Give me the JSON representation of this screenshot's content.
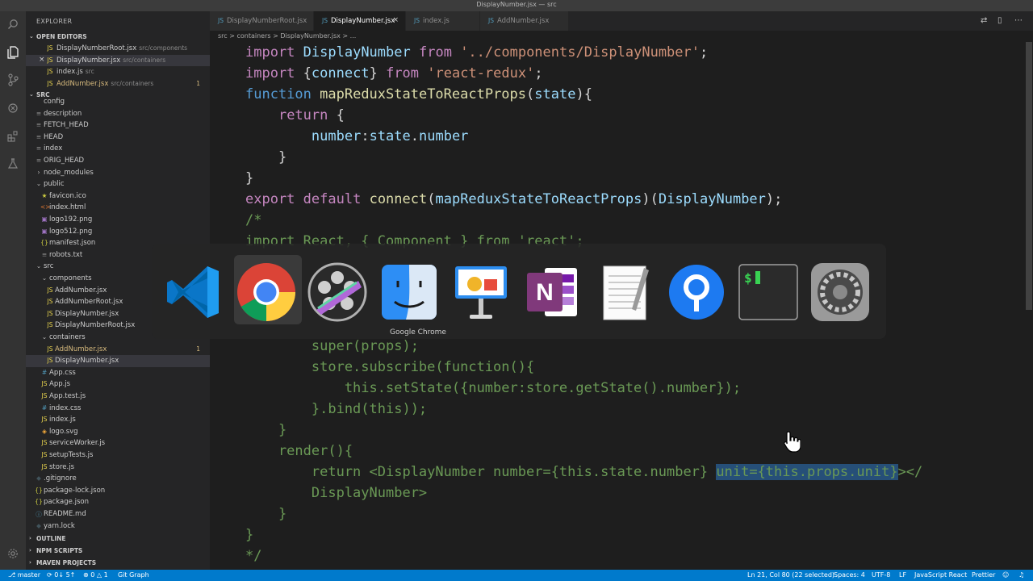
{
  "window": {
    "title": "DisplayNumber.jsx — src"
  },
  "activity_icons": [
    "search-icon",
    "files-icon",
    "source-control-icon",
    "debug-icon",
    "extensions-icon",
    "test-flask-icon",
    "settings-gear-icon"
  ],
  "sidebar": {
    "header": "EXPLORER",
    "open_editors": {
      "label": "OPEN EDITORS",
      "items": [
        {
          "icon": "JS",
          "name": "DisplayNumberRoot.jsx",
          "desc": "src/components"
        },
        {
          "icon": "JS",
          "name": "DisplayNumber.jsx",
          "desc": "src/containers"
        },
        {
          "icon": "JS",
          "name": "index.js",
          "desc": "src"
        },
        {
          "icon": "JS",
          "name": "AddNumber.jsx",
          "desc": "src/containers",
          "badge": "1"
        }
      ]
    },
    "src_label": "SRC",
    "tree": [
      {
        "icon": "",
        "name": "config"
      },
      {
        "icon": "≡",
        "name": "description"
      },
      {
        "icon": "≡",
        "name": "FETCH_HEAD"
      },
      {
        "icon": "≡",
        "name": "HEAD"
      },
      {
        "icon": "≡",
        "name": "index"
      },
      {
        "icon": "≡",
        "name": "ORIG_HEAD"
      },
      {
        "icon": "›",
        "name": "node_modules"
      },
      {
        "icon": "⌄",
        "name": "public"
      },
      {
        "icon": "★",
        "name": "favicon.ico"
      },
      {
        "icon": "<>",
        "name": "index.html"
      },
      {
        "icon": "▣",
        "name": "logo192.png"
      },
      {
        "icon": "▣",
        "name": "logo512.png"
      },
      {
        "icon": "{}",
        "name": "manifest.json"
      },
      {
        "icon": "≡",
        "name": "robots.txt"
      },
      {
        "icon": "⌄",
        "name": "src"
      },
      {
        "icon": "⌄",
        "name": "components"
      },
      {
        "icon": "JS",
        "name": "AddNumber.jsx"
      },
      {
        "icon": "JS",
        "name": "AddNumberRoot.jsx"
      },
      {
        "icon": "JS",
        "name": "DisplayNumber.jsx"
      },
      {
        "icon": "JS",
        "name": "DisplayNumberRoot.jsx"
      },
      {
        "icon": "⌄",
        "name": "containers"
      },
      {
        "icon": "JS",
        "name": "AddNumber.jsx",
        "badge": "1"
      },
      {
        "icon": "JS",
        "name": "DisplayNumber.jsx"
      },
      {
        "icon": "#",
        "name": "App.css"
      },
      {
        "icon": "JS",
        "name": "App.js"
      },
      {
        "icon": "JS",
        "name": "App.test.js"
      },
      {
        "icon": "#",
        "name": "index.css"
      },
      {
        "icon": "JS",
        "name": "index.js"
      },
      {
        "icon": "◈",
        "name": "logo.svg"
      },
      {
        "icon": "JS",
        "name": "serviceWorker.js"
      },
      {
        "icon": "JS",
        "name": "setupTests.js"
      },
      {
        "icon": "JS",
        "name": "store.js"
      },
      {
        "icon": "◆",
        "name": ".gitignore"
      },
      {
        "icon": "{}",
        "name": "package-lock.json"
      },
      {
        "icon": "{}",
        "name": "package.json"
      },
      {
        "icon": "ⓘ",
        "name": "README.md"
      },
      {
        "icon": "◆",
        "name": "yarn.lock"
      }
    ],
    "outline_label": "OUTLINE",
    "npm_label": "NPM SCRIPTS",
    "maven_label": "MAVEN PROJECTS"
  },
  "tabs": [
    {
      "icon": "JS",
      "label": "DisplayNumberRoot.jsx"
    },
    {
      "icon": "JS",
      "label": "DisplayNumber.jsx",
      "close": "×"
    },
    {
      "icon": "JS",
      "label": "index.js"
    },
    {
      "icon": "JS",
      "label": "AddNumber.jsx"
    }
  ],
  "breadcrumb": "src > containers > DisplayNumber.jsx > ...",
  "app_switcher": {
    "apps": [
      {
        "name": "Visual Studio Code",
        "icon": "vscode-icon"
      },
      {
        "name": "Google Chrome",
        "icon": "chrome-icon"
      },
      {
        "name": "Final Cut Pro",
        "icon": "final-cut-icon"
      },
      {
        "name": "Finder",
        "icon": "finder-icon"
      },
      {
        "name": "Keynote",
        "icon": "keynote-icon"
      },
      {
        "name": "OneNote",
        "icon": "onenote-icon"
      },
      {
        "name": "TextEdit",
        "icon": "textedit-icon"
      },
      {
        "name": "Sourcetree",
        "icon": "sourcetree-icon"
      },
      {
        "name": "Terminal",
        "icon": "terminal-icon"
      },
      {
        "name": "System Preferences",
        "icon": "system-preferences-icon"
      }
    ],
    "selected_label": "Google Chrome"
  },
  "code_lines": [
    "import DisplayNumber from '../components/DisplayNumber';",
    "import {connect} from 'react-redux';",
    "function mapReduxStateToReactProps(state){",
    "    return {",
    "        number:state.number",
    "    }",
    "}",
    "export default connect(mapReduxStateToReactProps)(DisplayNumber);",
    "/*",
    "import React, { Component } from 'react';",
    "        super(props);",
    "        store.subscribe(function(){",
    "            this.setState({number:store.getState().number});",
    "        }.bind(this));",
    "    }",
    "    render(){",
    "        return <DisplayNumber number={this.state.number} unit={this.props.unit}></",
    "        DisplayNumber>",
    "    }",
    "}",
    "*/"
  ],
  "status": {
    "branch": "master",
    "sync": "0↓ 5↑",
    "problems": "0 △ 1",
    "git_graph": "Git Graph",
    "position": "Ln 21, Col 80 (22 selected)",
    "spaces": "Spaces: 4",
    "encoding": "UTF-8",
    "eol": "LF",
    "language": "JavaScript React",
    "formatter": "Prettier"
  }
}
